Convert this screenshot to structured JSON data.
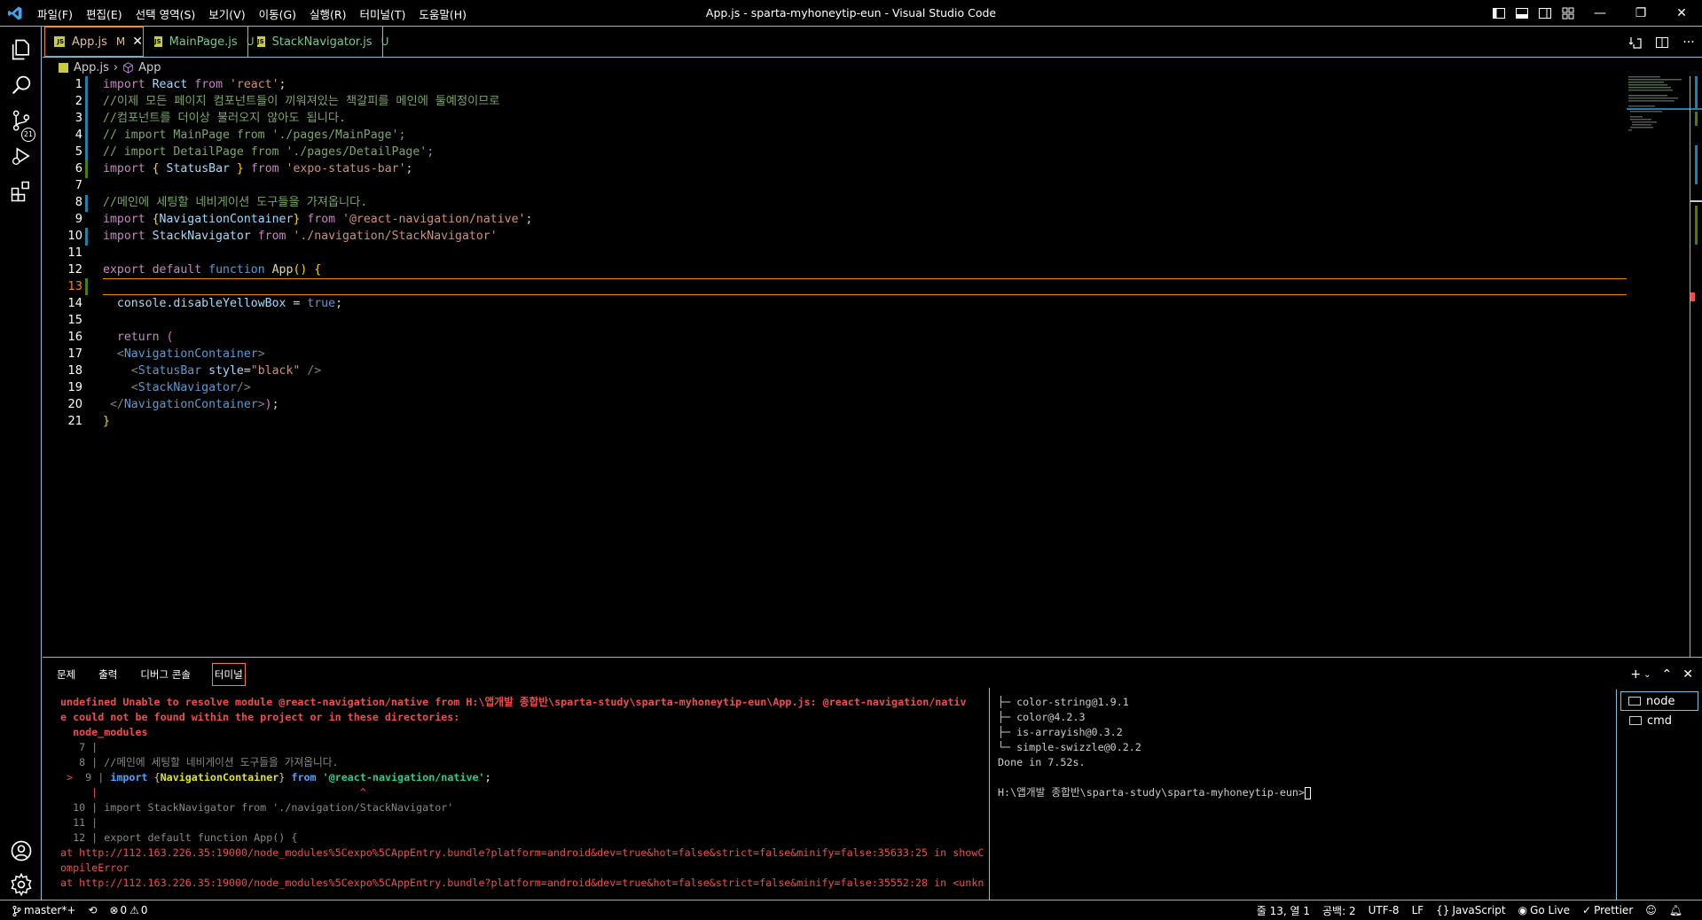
{
  "window": {
    "title": "App.js - sparta-myhoneytip-eun - Visual Studio Code",
    "menu": [
      "파일(F)",
      "편집(E)",
      "선택 영역(S)",
      "보기(V)",
      "이동(G)",
      "실행(R)",
      "터미널(T)",
      "도움말(H)"
    ]
  },
  "activity": {
    "scm_badge": "21"
  },
  "tabs": [
    {
      "name": "App.js",
      "status": "M",
      "active": true
    },
    {
      "name": "MainPage.js",
      "status": "U",
      "active": false
    },
    {
      "name": "StackNavigator.js",
      "status": "U",
      "active": false
    }
  ],
  "breadcrumb": {
    "file": "App.js",
    "symbol": "App"
  },
  "editor": {
    "current_line": 13,
    "line_numbers": [
      "1",
      "2",
      "3",
      "4",
      "5",
      "6",
      "7",
      "8",
      "9",
      "10",
      "11",
      "12",
      "13",
      "14",
      "15",
      "16",
      "17",
      "18",
      "19",
      "20",
      "21"
    ]
  },
  "panel": {
    "tabs": [
      "문제",
      "출력",
      "디버그 콘솔",
      "터미널"
    ],
    "active_tab": "터미널",
    "terminal1": {
      "error1": "undefined Unable to resolve module @react-navigation/native from H:\\앱개발 종합반\\sparta-study\\sparta-myhoneytip-eun\\App.js: @react-navigation/nativ",
      "error2": "e could not be found within the project or in these directories:",
      "error3": "  node_modules",
      "ctx7": "   7 |",
      "ctx8_num": "   8 | ",
      "ctx8_text": "//메인에 세팅할 네비게이션 도구들을 가져옵니다.",
      "ctx9_marker": " > ",
      "ctx9_num": " 9 | ",
      "ctx9_import": "import ",
      "ctx9_brace_open": "{",
      "ctx9_name": "NavigationContainer",
      "ctx9_brace_close": "}",
      "ctx9_from": " from ",
      "ctx9_str": "'@react-navigation/native'",
      "ctx9_end": ";",
      "caret": "     |                                          ^",
      "ctx10_num": "  10 | ",
      "ctx10_text": "import StackNavigator from './navigation/StackNavigator'",
      "ctx11": "  11 |",
      "ctx12_num": "  12 | ",
      "ctx12_text": "export default function App() {",
      "at1": "at http://112.163.226.35:19000/node_modules%5Cexpo%5CAppEntry.bundle?platform=android&dev=true&hot=false&strict=false&minify=false:35633:25 in showC",
      "at1b": "ompileError",
      "at2": "at http://112.163.226.35:19000/node_modules%5Cexpo%5CAppEntry.bundle?platform=android&dev=true&hot=false&strict=false&minify=false:35552:28 in <unkn"
    },
    "terminal2": {
      "lines": [
        "├─ color-string@1.9.1",
        "├─ color@4.2.3",
        "├─ is-arrayish@0.3.2",
        "└─ simple-swizzle@0.2.2",
        "Done in 7.52s.",
        "",
        "H:\\앱개발 종합반\\sparta-study\\sparta-myhoneytip-eun>"
      ]
    },
    "terminal_list": [
      "node",
      "cmd"
    ]
  },
  "statusbar": {
    "branch": "master*+",
    "errors": "0",
    "warnings": "0",
    "position": "줄 13, 열 1",
    "spaces": "공백: 2",
    "encoding": "UTF-8",
    "eol": "LF",
    "language": "JavaScript",
    "golive": "Go Live",
    "prettier": "Prettier"
  },
  "colors": {
    "border": "#6fc3df",
    "active_border": "#f38518",
    "error_red": "#f14c4c"
  }
}
